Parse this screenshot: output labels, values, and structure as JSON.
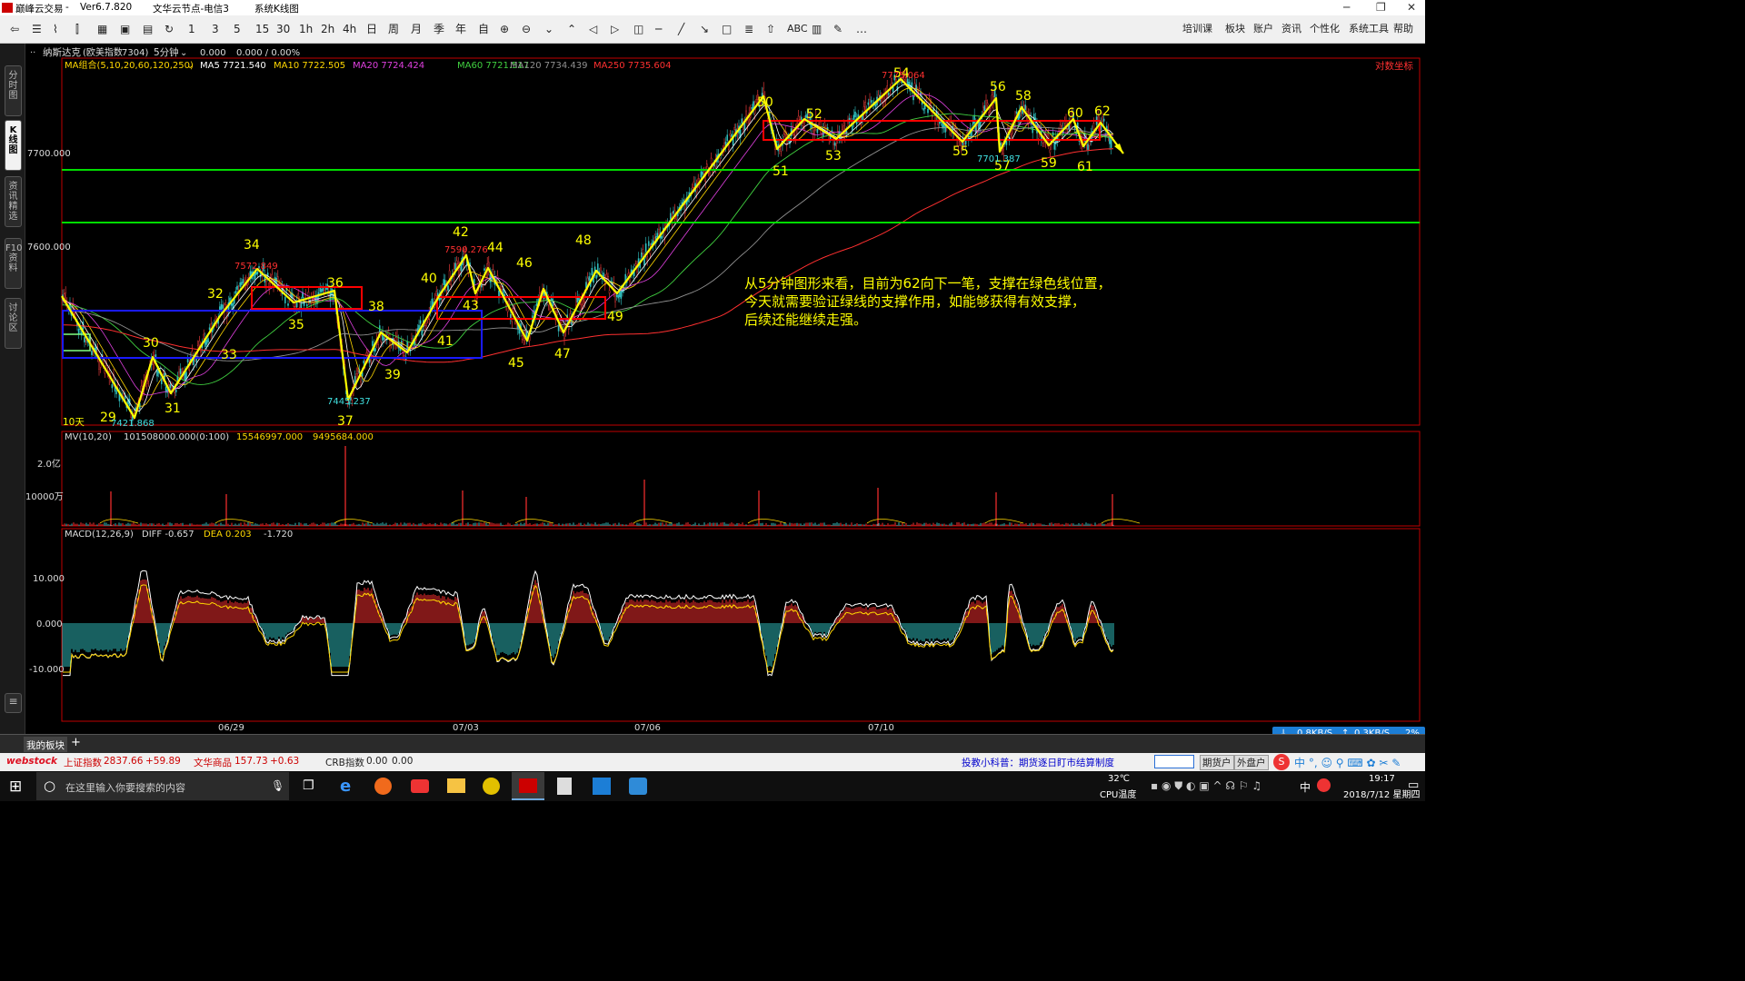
{
  "window": {
    "title": "巅峰云交易",
    "version": "Ver6.7.820",
    "server": "文华云节点-电信3",
    "mode": "系统K线图"
  },
  "toolbar": {
    "periods": [
      "1",
      "3",
      "5",
      "15",
      "30",
      "1h",
      "2h",
      "4h",
      "日",
      "周",
      "月",
      "季",
      "年",
      "自"
    ],
    "draw_text": "ABC",
    "right_menu": [
      "培训课",
      "板块",
      "账户",
      "资讯",
      "个性化",
      "系统工具",
      "帮助"
    ]
  },
  "side_tabs": [
    "分时图",
    "K线图",
    "资讯精选",
    "F10资料",
    "讨论区"
  ],
  "instrument": {
    "name": "纳斯达克",
    "market": "(欧美指数",
    "code": "7304)",
    "period": "5分钟",
    "price": "0.000",
    "change": "0.000 / 0.00%",
    "log_axis": "对数坐标"
  },
  "ma_legend": [
    {
      "label": "MA组合(5,10,20,60,120,250)",
      "color": "#ffd700"
    },
    {
      "label": "MA5 7721.540",
      "color": "#ffffff"
    },
    {
      "label": "MA10 7722.505",
      "color": "#ffd700"
    },
    {
      "label": "MA20 7724.424",
      "color": "#e040e0"
    },
    {
      "label": "MA60 7721.517",
      "color": "#40d040"
    },
    {
      "label": "MA120 7734.439",
      "color": "#909090"
    },
    {
      "label": "MA250 7735.604",
      "color": "#ff3030"
    }
  ],
  "annotation_lines": [
    "从5分钟图形来看，目前为62向下一笔，支撑在绿色线位置，",
    "今天就需要验证绿线的支撑作用，如能够获得有效支撑，",
    "后续还能继续走强。"
  ],
  "price_marks": {
    "low1": "7421.868",
    "high1": "7572.849",
    "low2": "7445.237",
    "high2": "7590.276",
    "top": "7775.064",
    "low3": "7701.387"
  },
  "days_label": "10天",
  "mv": {
    "label": "MV(10,20)",
    "v1": "101508000.000(0:100)",
    "v2": "15546997.000",
    "v3": "9495684.000",
    "ticks": [
      "2.0亿",
      "10000万"
    ]
  },
  "macd": {
    "label": "MACD(12,26,9)",
    "diff": "DIFF -0.657",
    "dea": "DEA 0.203",
    "value": "-1.720",
    "ticks": [
      "10.000",
      "0.000",
      "-10.000"
    ]
  },
  "price_axis": [
    "7700.000",
    "7600.000"
  ],
  "dates": [
    "06/29",
    "07/03",
    "07/06",
    "07/10"
  ],
  "wave_numbers": [
    "29",
    "30",
    "31",
    "32",
    "33",
    "34",
    "35",
    "36",
    "37",
    "38",
    "39",
    "40",
    "41",
    "42",
    "43",
    "44",
    "45",
    "46",
    "47",
    "48",
    "49",
    "50",
    "51",
    "52",
    "53",
    "54",
    "55",
    "56",
    "57",
    "58",
    "59",
    "60",
    "61",
    "62"
  ],
  "bottom_tab": "我的板块",
  "status": {
    "brand": "webstock",
    "idx1_name": "上证指数",
    "idx1_val": "2837.66",
    "idx1_chg": "+59.89",
    "idx2_name": "文华商品",
    "idx2_val": "157.73",
    "idx2_chg": "+0.63",
    "idx3_name": "CRB指数",
    "idx3_val": "0.00",
    "idx3_chg": "0.00",
    "tip": "投教小科普：期货逐日盯市结算制度",
    "btn1": "期货户",
    "btn2": "外盘户"
  },
  "netspeed": {
    "down": "0.8KB/S",
    "up": "0.3KB/S",
    "pct": "2%"
  },
  "taskbar": {
    "search_placeholder": "在这里输入你要搜索的内容",
    "temp": "32℃",
    "temp_label": "CPU温度",
    "ime": "中",
    "time": "19:17",
    "date": "2018/7/12 星期四"
  },
  "colors": {
    "bg": "#000000",
    "axis": "#cc0000",
    "wave": "#ffff00",
    "support_line": "#00dd00",
    "box_red": "#ff0000",
    "box_blue": "#1a1aff",
    "annotation": "#ffff00"
  }
}
